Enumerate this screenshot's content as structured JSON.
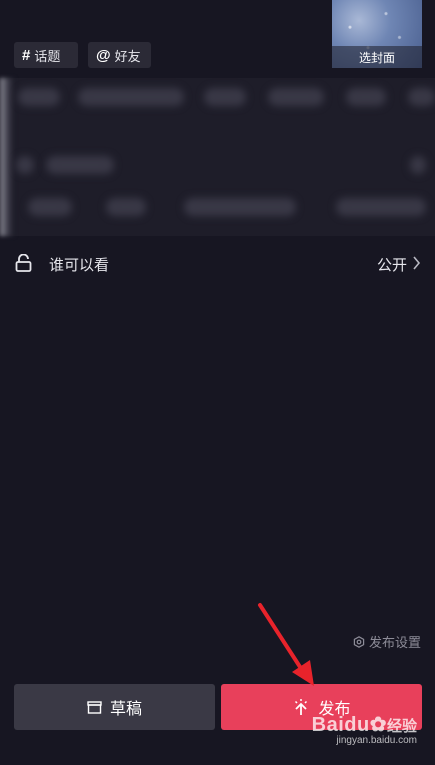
{
  "tags": {
    "topic": {
      "icon": "hash-icon",
      "label": "话题"
    },
    "friend": {
      "icon": "at-icon",
      "label": "好友"
    }
  },
  "cover": {
    "label": "选封面"
  },
  "privacy": {
    "label": "谁可以看",
    "value": "公开"
  },
  "publish_settings": {
    "label": "发布设置"
  },
  "buttons": {
    "draft": {
      "label": "草稿"
    },
    "publish": {
      "label": "发布"
    }
  },
  "colors": {
    "background": "#171622",
    "publish_accent": "#e8405b",
    "draft_bg": "#3a3945",
    "annotation_arrow": "#e8232b"
  },
  "watermark": {
    "brand": "Baidu",
    "brand_suffix": "经验",
    "url": "jingyan.baidu.com"
  }
}
